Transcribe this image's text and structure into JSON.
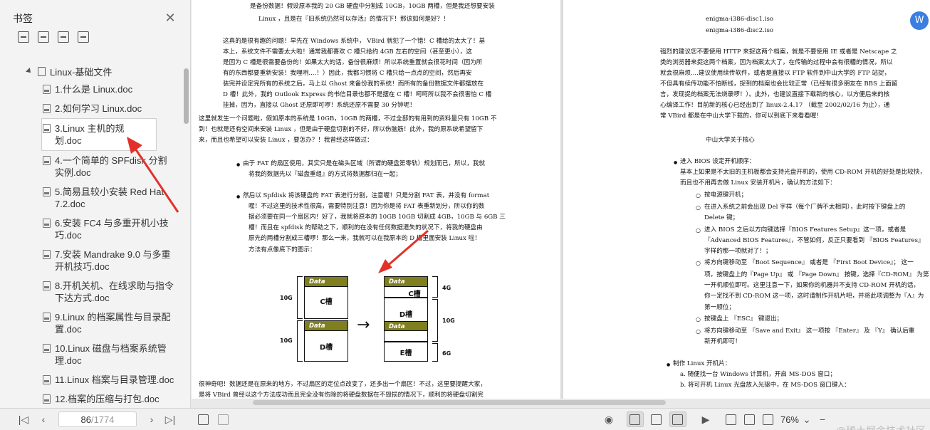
{
  "sidebar": {
    "title": "书签",
    "root_label": "Linux-基础文件",
    "items": [
      {
        "label": "1.什么是 Linux.doc"
      },
      {
        "label": "2.如何学习 Linux.doc"
      },
      {
        "label": "3.Linux 主机的规划.doc"
      },
      {
        "label": "4.一个简单的 SPFdisk 分割实例.doc"
      },
      {
        "label": "5.简易且较小安装 Red Hat 7.2.doc"
      },
      {
        "label": "6.安装 FC4 与多重开机小技巧.doc"
      },
      {
        "label": "7.安装 Mandrake 9.0 与多重开机技巧.doc"
      },
      {
        "label": "8.开机关机、在线求助与指令下达方式.doc"
      },
      {
        "label": "9.Linux 的档案属性与目录配置.doc"
      },
      {
        "label": "10.Linux 磁盘与档案系统管理.doc"
      },
      {
        "label": "11.Linux 档案与目录管理.doc"
      },
      {
        "label": "12.档案的压缩与打包.doc"
      }
    ]
  },
  "left_page": {
    "lines": [
      "是备份数据！假设原本我的 20 GB 硬盘中分割成 10GB，10GB 两槽，但是我还想要安装",
      "Linux ，且是在『旧系统仍然可以存活』的情况下！那该如何是好？！",
      "这真的是很有趣的问题！早先在 Windows 系统中， VBird 就犯了一个错！C 槽给的太大了！基",
      "本上，系统文件不需要太大啦！通常我都喜欢 C 槽只给约 4GB 左右的空间（甚至更小），这",
      "是因为 C 槽是很需要备份的！如果太大的话，备份很麻烦！所以系统重置就会很花时间（因为所",
      "有的东西都要重新安装！我哩咧....！）因此，我都习惯将 C 槽只给一点点的空间，然后再安",
      "装完并设定完所有的系统之后，马上以 Ghost 来备份我的系统！而所有的备份数据文件都摆放在",
      "D 槽！此外，我的 Outlook Express 的书信目录也都不是摆在 C 槽！呵呵所以我不会很害怕 C 槽",
      "挂掉，因为，直接以 Ghost 还原即可啰！系统还原不需要 30 分钟呢！",
      "这里就发生一个问题啦，假如原本的系统是 10GB，10GB 的两槽，不过全部的有用到的资料量只有 10GB 不",
      "到！也就是还有空间来安装 Linux ，但是由于硬盘切割的不好，所以伤脑筋！此外，我的原系统希望留下",
      "来，而且也希望可以安装 Linux ，要怎办？！我曾经这样做过：",
      "由于 FAT 的扇区使用，其实只是在磁头区域（所谓的硬盘第零轨）规划而已，所以，我就",
      "将我的数据先以『磁盘重组』的方式将数据都归在一起；",
      "然后以 Spfdisk 将该硬盘的 FAT 表进行分割，注意喔！只是分割 FAT 表，并没有 format",
      "喔！不过这里的技术性很高，需要特别注意！因为你是将 FAT 表重新划分，所以你的数",
      "据必须要在同一个扇区内！好了，我就将原本的 10GB 10GB 切割成 4GB，10GB 与 6GB 三",
      "槽！而且在 spfdisk 的帮助之下，顺利的在没有任何数据遗失的状况下，将我的硬盘由",
      "原先的两槽分割成三槽啰！那么一来，我就可以在我原本的 D 槽里面安装 Linux 啦！",
      "方法有点像底下的图示：",
      "很神奇吧！数据还是在原来的地方，不过扇区的定位点改变了，还多出一个扇区！不过，这里要提醒大家，",
      "是将 VBird 曾经以这个方法成功而且完全没有伤除的将硬盘数据在不毁损的情况下，顺利的将硬盘切割完"
    ],
    "diagram": {
      "data_label": "Data",
      "c_label": "C槽",
      "d_label": "D槽",
      "e_label": "E槽",
      "size_10g_a": "10G",
      "size_10g_b": "10G",
      "size_4g": "4G",
      "size_10g_c": "10G",
      "size_6g": "6G",
      "arrow": "→"
    }
  },
  "right_page": {
    "lines": [
      "enigma-i386-disc1.iso",
      "enigma-i386-disc2.iso",
      "强烈的建议您不要使用 HTTP 来捉这两个档案，就是不要使用 IE 或者是 Netscape 之",
      "类的浏览器来捉这两个档案，因为档案太大了，在传输的过程中会有很糟的情况，所以",
      "就会很麻烦....建议使用续传软件，或者是直接以 FTP 软件到中山大学的 FTP 站捉，",
      "不但具有续传功能不怕断线，捉到的档案也会比较正常（已经有很多朋友在 BBS 上面留",
      "言，发现捉的档案无法烧录啰！）。此外，也建议直接下载新的核心，以方便后来的核",
      "心编译工作！目前新的核心已经出到了 linux-2.4.17 （截至 2002/02/16 为止），通",
      "常 VBird 都是在中山大学下载的，你可以到底下来看看喔！",
      "中山大学关于核心",
      "进入 BIOS 设定开机顺序：",
      "基本上如果是不太旧的主机板都会支持光盘开机的，使用 CD-ROM 开机的好处是比较快，",
      "而且也不用再去做 Linux 安装开机片，确认的方法如下：",
      "按电源键开机；",
      "在进入系统之前会出现 Del 字样（每个厂牌不太相同），此时按下键盘上的",
      "Delete 键；",
      "进入 BIOS 之后以方向键选择『BIOS Features Setup』这一项，或者是",
      "『Advanced BIOS Features』，不管如何，反正只要看到 『BIOS Features』",
      "字样的那一项就对了！；",
      "将方向键移动至 『Boot Sequence』 或者是 『First Boot Device』；  这一",
      "项，按键盘上的『Page Up』 或 『Page Down』 按键，选择『CD-ROM』 为第",
      "一开机顺位即可。这里注意一下，如果你的机器并不支持 CD-ROM 开机的话，",
      "你一定找不到 CD-ROM 这一项，这时请制作开机片吧，并将此项调整为『A』为",
      "第一顺位；",
      "按键盘上 『ESC』 键退出；",
      "将方向键移动至 『Save and Exit』 这一项按 『Enter』 及 『Y』 确认后重",
      "新开机即可！",
      "制作 Linux 开机片：",
      "a. 随便找一台 Windows 计算机，开启 MS-DOS 窗口；",
      "b. 将可开机 Linux 光盘放入光驱中，在 MS-DOS 窗口键入："
    ]
  },
  "float_button": {
    "label": "W"
  },
  "statusbar": {
    "current_page": "86",
    "total_pages": "/1774",
    "zoom": "76%",
    "watermark": "@稀土掘金技术社区"
  },
  "colors": {
    "annotation_red": "#e2312a",
    "data_slot": "#7f7f1f",
    "accent_blue": "#3b7de0"
  }
}
